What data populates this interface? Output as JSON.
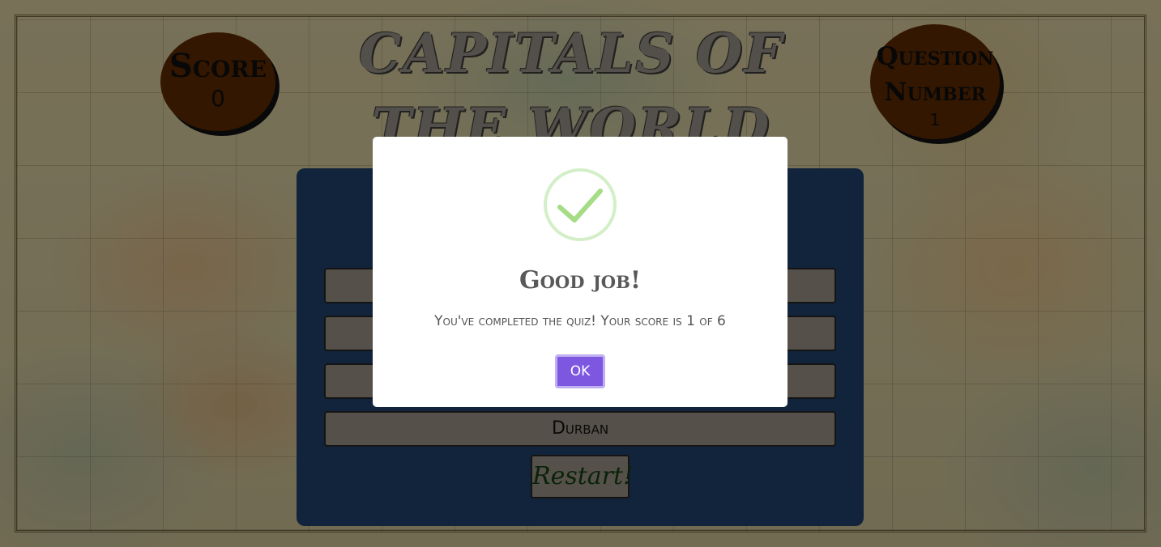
{
  "title": "Capitals of the World",
  "score": {
    "label": "Score",
    "value": "0"
  },
  "question_number": {
    "label": "Question Number",
    "value": "1"
  },
  "answers": [
    "",
    "",
    "",
    "Durban"
  ],
  "restart_label": "Restart!",
  "modal": {
    "icon": "checkmark-icon",
    "title": "Good job!",
    "text": "You've completed the quiz! Your score is 1 of 6",
    "ok_label": "OK"
  },
  "colors": {
    "panel": "#1e3f66",
    "badge": "#5a2800",
    "ok_button": "#7e57e0",
    "success_check": "#a5dc86"
  }
}
